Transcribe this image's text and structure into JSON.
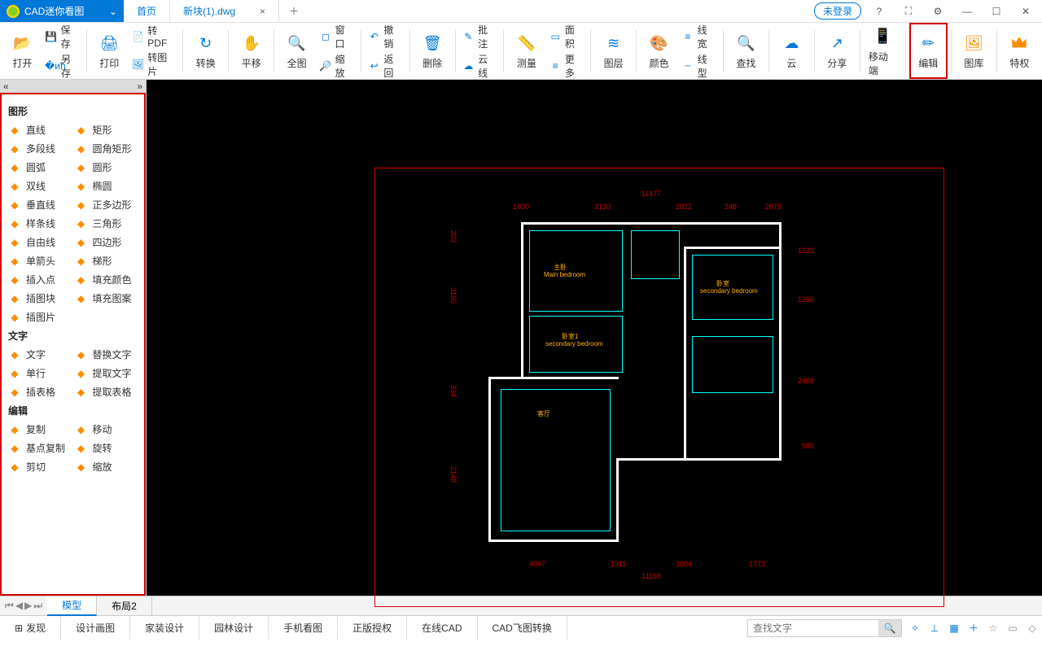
{
  "title": {
    "app": "CAD迷你看图",
    "tab_home": "首页",
    "tab_file": "新块(1).dwg",
    "login": "未登录"
  },
  "ribbon": {
    "open": "打开",
    "save": "保存",
    "save_as": "另存",
    "print": "打印",
    "to_pdf": "转PDF",
    "to_img": "转图片",
    "convert": "转换",
    "pan": "平移",
    "full": "全图",
    "window": "窗口",
    "zoom": "缩放",
    "undo": "撤销",
    "back": "返回",
    "delete": "删除",
    "annotate": "批注",
    "cloud_line": "云线",
    "measure": "测量",
    "area": "面积",
    "more": "更多",
    "layer": "图层",
    "color": "颜色",
    "line_w": "线宽",
    "line_t": "线型",
    "find": "查找",
    "cloud": "云",
    "share": "分享",
    "mobile": "移动端",
    "edit": "编辑",
    "library": "图库",
    "vip": "特权"
  },
  "sidebar": {
    "sec_shape": "图形",
    "sec_text": "文字",
    "sec_edit": "编辑",
    "shapes": [
      [
        "直线",
        "矩形"
      ],
      [
        "多段线",
        "圆角矩形"
      ],
      [
        "圆弧",
        "圆形"
      ],
      [
        "双线",
        "椭圆"
      ],
      [
        "垂直线",
        "正多边形"
      ],
      [
        "样条线",
        "三角形"
      ],
      [
        "自由线",
        "四边形"
      ],
      [
        "单箭头",
        "梯形"
      ],
      [
        "插入点",
        "填充颜色"
      ],
      [
        "插图块",
        "填充图案"
      ],
      [
        "插图片",
        ""
      ]
    ],
    "texts": [
      [
        "文字",
        "替换文字"
      ],
      [
        "单行",
        "提取文字"
      ],
      [
        "插表格",
        "提取表格"
      ]
    ],
    "edits": [
      [
        "复制",
        "移动"
      ],
      [
        "基点复制",
        "旋转"
      ],
      [
        "剪切",
        "缩放"
      ]
    ]
  },
  "drawing": {
    "dim_top": "11477",
    "dim_row": [
      "1800",
      "3130",
      "2022",
      "248",
      "2075"
    ],
    "dim_bottom": "11168",
    "dim_bot_row": [
      "4097",
      "1911",
      "3094",
      "1773"
    ],
    "dim_right": [
      "1229",
      "1260",
      "2468",
      "985"
    ],
    "dim_left": [
      "203",
      "3160",
      "334",
      "2148"
    ],
    "rooms": {
      "r1": "主卧",
      "r1b": "Main bedroom",
      "r2": "卧室",
      "r2b": "secondary bedroom",
      "r3": "卧室1",
      "r3b": "secondary bedroom",
      "r4": "客厅"
    }
  },
  "bottom_tabs": {
    "model": "模型",
    "layout": "布局2"
  },
  "status": {
    "discover": "发现",
    "design": "设计画图",
    "home": "家装设计",
    "garden": "园林设计",
    "phone": "手机看图",
    "auth": "正版授权",
    "online": "在线CAD",
    "fast": "CAD飞图转换",
    "search_ph": "查找文字"
  }
}
